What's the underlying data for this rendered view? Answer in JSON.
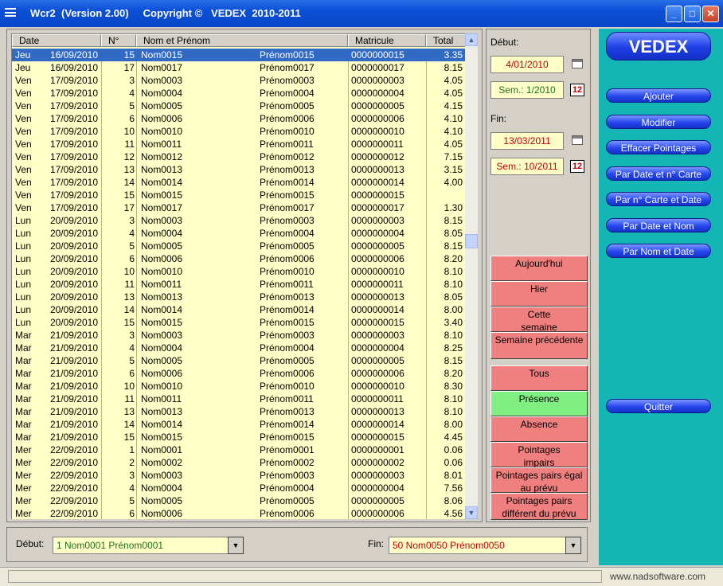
{
  "window": {
    "title": "Wcr2  (Version 2.00)     Copyright ©   VEDEX  2010-2011",
    "min": "_",
    "max": "□",
    "close": "✕"
  },
  "grid": {
    "columns": [
      "Date",
      "N°",
      "Nom et Prénom",
      "Matricule",
      "Total"
    ],
    "rows": [
      [
        "Jeu",
        "16/09/2010",
        "15",
        "Nom0015",
        "Prénom0015",
        "0000000015",
        "3.35"
      ],
      [
        "Jeu",
        "16/09/2010",
        "17",
        "Nom0017",
        "Prénom0017",
        "0000000017",
        "8.15"
      ],
      [
        "Ven",
        "17/09/2010",
        "3",
        "Nom0003",
        "Prénom0003",
        "0000000003",
        "4.05"
      ],
      [
        "Ven",
        "17/09/2010",
        "4",
        "Nom0004",
        "Prénom0004",
        "0000000004",
        "4.05"
      ],
      [
        "Ven",
        "17/09/2010",
        "5",
        "Nom0005",
        "Prénom0005",
        "0000000005",
        "4.15"
      ],
      [
        "Ven",
        "17/09/2010",
        "6",
        "Nom0006",
        "Prénom0006",
        "0000000006",
        "4.10"
      ],
      [
        "Ven",
        "17/09/2010",
        "10",
        "Nom0010",
        "Prénom0010",
        "0000000010",
        "4.10"
      ],
      [
        "Ven",
        "17/09/2010",
        "11",
        "Nom0011",
        "Prénom0011",
        "0000000011",
        "4.05"
      ],
      [
        "Ven",
        "17/09/2010",
        "12",
        "Nom0012",
        "Prénom0012",
        "0000000012",
        "7.15"
      ],
      [
        "Ven",
        "17/09/2010",
        "13",
        "Nom0013",
        "Prénom0013",
        "0000000013",
        "3.15"
      ],
      [
        "Ven",
        "17/09/2010",
        "14",
        "Nom0014",
        "Prénom0014",
        "0000000014",
        "4.00"
      ],
      [
        "Ven",
        "17/09/2010",
        "15",
        "Nom0015",
        "Prénom0015",
        "0000000015",
        ""
      ],
      [
        "Ven",
        "17/09/2010",
        "17",
        "Nom0017",
        "Prénom0017",
        "0000000017",
        "1.30"
      ],
      [
        "Lun",
        "20/09/2010",
        "3",
        "Nom0003",
        "Prénom0003",
        "0000000003",
        "8.15"
      ],
      [
        "Lun",
        "20/09/2010",
        "4",
        "Nom0004",
        "Prénom0004",
        "0000000004",
        "8.05"
      ],
      [
        "Lun",
        "20/09/2010",
        "5",
        "Nom0005",
        "Prénom0005",
        "0000000005",
        "8.15"
      ],
      [
        "Lun",
        "20/09/2010",
        "6",
        "Nom0006",
        "Prénom0006",
        "0000000006",
        "8.20"
      ],
      [
        "Lun",
        "20/09/2010",
        "10",
        "Nom0010",
        "Prénom0010",
        "0000000010",
        "8.10"
      ],
      [
        "Lun",
        "20/09/2010",
        "11",
        "Nom0011",
        "Prénom0011",
        "0000000011",
        "8.10"
      ],
      [
        "Lun",
        "20/09/2010",
        "13",
        "Nom0013",
        "Prénom0013",
        "0000000013",
        "8.05"
      ],
      [
        "Lun",
        "20/09/2010",
        "14",
        "Nom0014",
        "Prénom0014",
        "0000000014",
        "8.00"
      ],
      [
        "Lun",
        "20/09/2010",
        "15",
        "Nom0015",
        "Prénom0015",
        "0000000015",
        "3.40"
      ],
      [
        "Mar",
        "21/09/2010",
        "3",
        "Nom0003",
        "Prénom0003",
        "0000000003",
        "8.10"
      ],
      [
        "Mar",
        "21/09/2010",
        "4",
        "Nom0004",
        "Prénom0004",
        "0000000004",
        "8.25"
      ],
      [
        "Mar",
        "21/09/2010",
        "5",
        "Nom0005",
        "Prénom0005",
        "0000000005",
        "8.15"
      ],
      [
        "Mar",
        "21/09/2010",
        "6",
        "Nom0006",
        "Prénom0006",
        "0000000006",
        "8.20"
      ],
      [
        "Mar",
        "21/09/2010",
        "10",
        "Nom0010",
        "Prénom0010",
        "0000000010",
        "8.30"
      ],
      [
        "Mar",
        "21/09/2010",
        "11",
        "Nom0011",
        "Prénom0011",
        "0000000011",
        "8.10"
      ],
      [
        "Mar",
        "21/09/2010",
        "13",
        "Nom0013",
        "Prénom0013",
        "0000000013",
        "8.10"
      ],
      [
        "Mar",
        "21/09/2010",
        "14",
        "Nom0014",
        "Prénom0014",
        "0000000014",
        "8.00"
      ],
      [
        "Mar",
        "21/09/2010",
        "15",
        "Nom0015",
        "Prénom0015",
        "0000000015",
        "4.45"
      ],
      [
        "Mer",
        "22/09/2010",
        "1",
        "Nom0001",
        "Prénom0001",
        "0000000001",
        "0.06"
      ],
      [
        "Mer",
        "22/09/2010",
        "2",
        "Nom0002",
        "Prénom0002",
        "0000000002",
        "0.06"
      ],
      [
        "Mer",
        "22/09/2010",
        "3",
        "Nom0003",
        "Prénom0003",
        "0000000003",
        "8.01"
      ],
      [
        "Mer",
        "22/09/2010",
        "4",
        "Nom0004",
        "Prénom0004",
        "0000000004",
        "7.56"
      ],
      [
        "Mer",
        "22/09/2010",
        "5",
        "Nom0005",
        "Prénom0005",
        "0000000005",
        "8.06"
      ],
      [
        "Mer",
        "22/09/2010",
        "6",
        "Nom0006",
        "Prénom0006",
        "0000000006",
        "4.56"
      ]
    ],
    "selected_row": 0,
    "scroll_up": "▲",
    "scroll_down": "▼"
  },
  "bottom": {
    "start_label": "Début:",
    "start_value": "1 Nom0001 Prénom0001",
    "end_label": "Fin:",
    "end_value": "50 Nom0050 Prénom0050",
    "dropdown_glyph": "▼"
  },
  "dates": {
    "start_label": "Début:",
    "start_date": "4/01/2010",
    "start_week": "Sem.: 1/2010",
    "end_label": "Fin:",
    "end_date": "13/03/2011",
    "end_week": "Sem.: 10/2011",
    "num_icon": "12"
  },
  "periods": [
    "Aujourd'hui",
    "Hier",
    "Cette semaine",
    "Semaine précédente"
  ],
  "filters": [
    "Tous",
    "Présence",
    "Absence",
    "Pointages impairs",
    "Pointages pairs égal au prévu",
    "Pointages pairs différent du prévu"
  ],
  "filter_active": 1,
  "colors": {
    "accent_blue": "#2546ee",
    "teal": "#13b5b5",
    "grid_bg": "#ffffc8",
    "filter_red": "#f07f7f",
    "filter_green": "#80ee80",
    "selected": "#316ac5"
  },
  "actions": {
    "brand": "VEDEX",
    "buttons": [
      "Ajouter",
      "Modifier",
      "Effacer Pointages",
      "Par Date et n° Carte",
      "Par n° Carte et Date",
      "Par Date et Nom",
      "Par Nom et Date"
    ],
    "quit": "Quitter"
  },
  "status": {
    "site": "www.nadsoftware.com"
  }
}
